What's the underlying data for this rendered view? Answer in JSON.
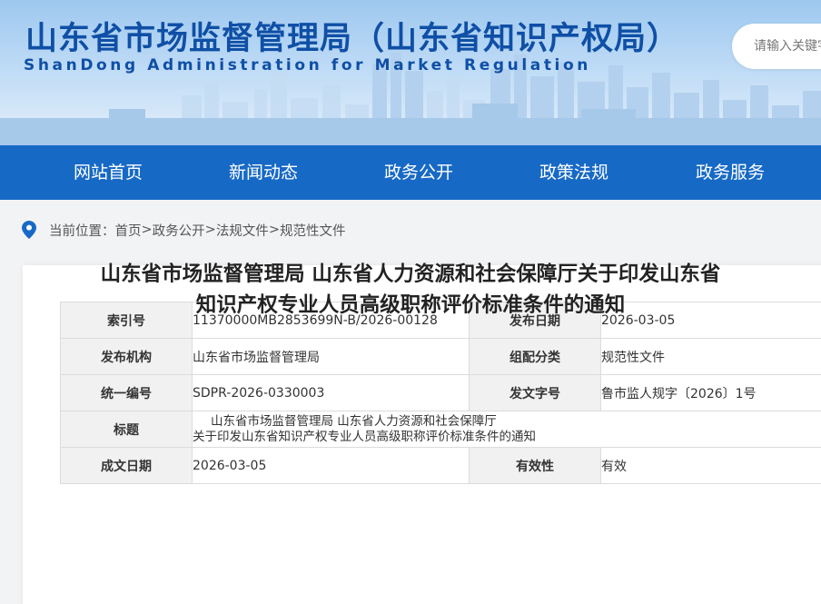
{
  "header": {
    "title": "山东省市场监督管理局（山东省知识产权局）",
    "subtitle": "ShanDong Administration for Market Regulation",
    "search_placeholder": "请输入关键字"
  },
  "nav": {
    "items": [
      "网站首页",
      "新闻动态",
      "政务公开",
      "政策法规",
      "政务服务"
    ]
  },
  "breadcrumb": {
    "prefix": "当前位置：",
    "items": [
      "首页",
      "政务公开",
      "法规文件",
      "规范性文件"
    ],
    "separator": ">"
  },
  "meta_table": {
    "rows": [
      {
        "label1": "索引号",
        "value1": "11370000MB2853699N-B/2026-00128",
        "label2": "发布日期",
        "value2": "2026-03-05"
      },
      {
        "label1": "发布机构",
        "value1": "山东省市场监督管理局",
        "label2": "组配分类",
        "value2": "规范性文件"
      },
      {
        "label1": "统一编号",
        "value1": "SDPR-2026-0330003",
        "label2": "发文字号",
        "value2": "鲁市监人规字〔2026〕1号"
      }
    ],
    "title_row": {
      "label": "标题",
      "line1": "山东省市场监督管理局 山东省人力资源和社会保障厅",
      "line2": "关于印发山东省知识产权专业人员高级职称评价标准条件的通知"
    },
    "last_row": {
      "label1": "成文日期",
      "value1": "2026-03-05",
      "label2": "有效性",
      "value2": "有效"
    }
  },
  "document": {
    "title_line1": "山东省市场监督管理局 山东省人力资源和社会保障厅关于印发山东省",
    "title_line2": "知识产权专业人员高级职称评价标准条件的通知"
  },
  "colors": {
    "brand_blue": "#1769c6",
    "title_blue": "#0f4fa6",
    "pin_icon": "#1769c6"
  },
  "icons": {
    "location": "map-pin-icon"
  }
}
